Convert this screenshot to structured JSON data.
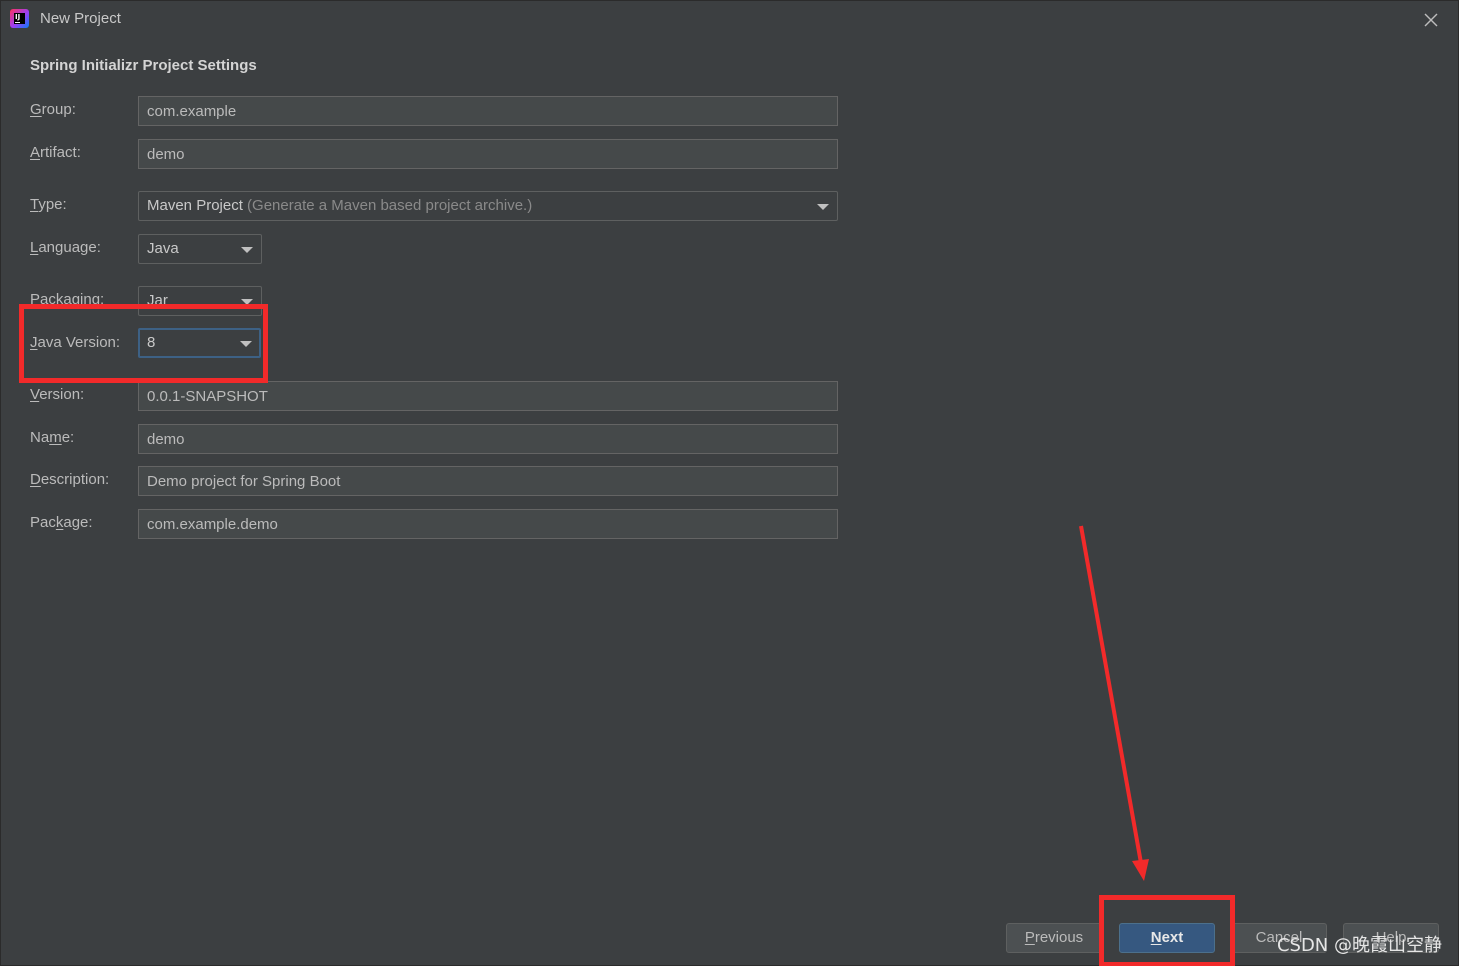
{
  "window": {
    "title": "New Project",
    "close_icon": "close-icon"
  },
  "section_title": "Spring Initializr Project Settings",
  "fields": {
    "group": {
      "label_mnemonic": "G",
      "label_rest": "roup:",
      "value": "com.example"
    },
    "artifact": {
      "label_mnemonic": "A",
      "label_rest": "rtifact:",
      "value": "demo"
    },
    "type": {
      "label_mnemonic": "T",
      "label_rest": "ype:",
      "value": "Maven Project",
      "hint": "(Generate a Maven based project archive.)"
    },
    "language": {
      "label_mnemonic": "L",
      "label_rest": "anguage:",
      "value": "Java"
    },
    "packaging": {
      "label_pre": "Pac",
      "label_mnemonic": "k",
      "label_rest": "aging:",
      "value": "Jar"
    },
    "java_version": {
      "label_mnemonic": "J",
      "label_rest": "ava Version:",
      "value": "8"
    },
    "version": {
      "label_mnemonic": "V",
      "label_rest": "ersion:",
      "value": "0.0.1-SNAPSHOT"
    },
    "name": {
      "label_pre": "Na",
      "label_mnemonic": "m",
      "label_rest": "e:",
      "value": "demo"
    },
    "description": {
      "label_mnemonic": "D",
      "label_rest": "escription:",
      "value": "Demo project for Spring Boot"
    },
    "package": {
      "label_pre": "Pac",
      "label_mnemonic": "k",
      "label_rest": "age:",
      "value": "com.example.demo"
    }
  },
  "buttons": {
    "previous": {
      "mnemonic": "P",
      "rest": "revious"
    },
    "next": {
      "mnemonic": "N",
      "rest": "ext"
    },
    "cancel": {
      "label": "Cancel"
    },
    "help": {
      "label": "Help"
    }
  },
  "annotations": {
    "highlight_color": "#f22a2a"
  },
  "watermark": "CSDN @晚霞山空静"
}
